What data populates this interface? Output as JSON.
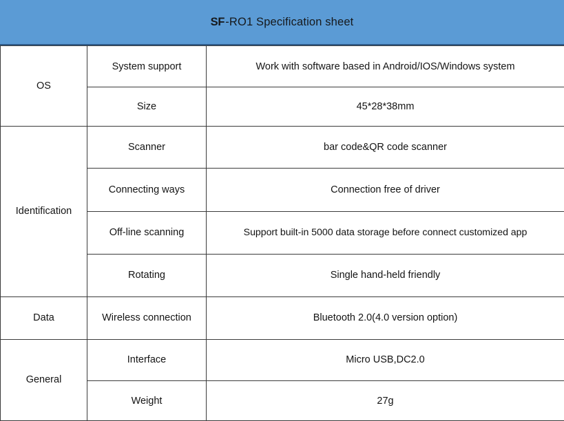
{
  "header": {
    "brand": "SF",
    "title_rest": "-RO1 Specification sheet",
    "full_title": "SF-RO1 Specification sheet",
    "background_color": "#5B9BD5",
    "border_color": "#2E5B8A"
  },
  "table": {
    "border_color": "#3A3A3A",
    "groups": [
      {
        "name": "OS",
        "rows": [
          {
            "item": "System support",
            "value": "Work with software based in Android/IOS/Windows system"
          },
          {
            "item": "Size",
            "value": "45*28*38mm"
          }
        ]
      },
      {
        "name": "Identification",
        "rows": [
          {
            "item": "Scanner",
            "value": "bar code&QR code scanner"
          },
          {
            "item": "Connecting ways",
            "value": "Connection free of driver"
          },
          {
            "item": "Off-line scanning",
            "value": "Support built-in 5000 data storage before connect customized app"
          },
          {
            "item": "Rotating",
            "value": "Single hand-held friendly"
          }
        ]
      },
      {
        "name": "Data",
        "rows": [
          {
            "item": "Wireless connection",
            "value": "Bluetooth 2.0(4.0 version option)"
          }
        ]
      },
      {
        "name": "General",
        "rows": [
          {
            "item": "Interface",
            "value": "Micro USB,DC2.0"
          },
          {
            "item": "Weight",
            "value": "27g"
          }
        ]
      }
    ]
  }
}
